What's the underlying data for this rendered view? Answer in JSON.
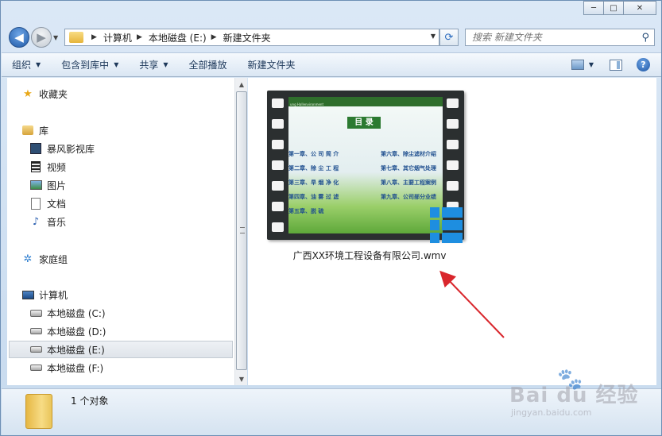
{
  "window": {
    "buttons": {
      "minimize": "─",
      "maximize": "□",
      "close": "✕"
    }
  },
  "address": {
    "breadcrumbs": [
      "计算机",
      "本地磁盘 (E:)",
      "新建文件夹"
    ],
    "separator": "▶"
  },
  "search": {
    "placeholder": "搜索 新建文件夹"
  },
  "toolbar": {
    "items": [
      {
        "label": "组织",
        "has_menu": true
      },
      {
        "label": "包含到库中",
        "has_menu": true
      },
      {
        "label": "共享",
        "has_menu": true
      },
      {
        "label": "全部播放",
        "has_menu": false
      },
      {
        "label": "新建文件夹",
        "has_menu": false
      }
    ],
    "help": "?"
  },
  "nav": {
    "favorites": "收藏夹",
    "libraries": "库",
    "library_items": [
      "暴风影视库",
      "视频",
      "图片",
      "文档",
      "音乐"
    ],
    "homegroup": "家庭组",
    "computer": "计算机",
    "drives": [
      "本地磁盘 (C:)",
      "本地磁盘 (D:)",
      "本地磁盘 (E:)",
      "本地磁盘 (F:)"
    ],
    "selected_drive": "本地磁盘 (E:)"
  },
  "file": {
    "name": "广西XX环境工程设备有限公司.wmv",
    "thumbnail": {
      "header": "ung Hallenvironment",
      "title": "目 录",
      "toc_left": [
        "第一章、公 司 简 介",
        "第二章、除 尘 工 程",
        "第三章、旱 烟 净 化",
        "第四章、油 雾 过 滤",
        "第五章、脱      硫"
      ],
      "toc_right": [
        "第六章、除尘滤材介绍",
        "第七章、其它烟气处理",
        "第八章、主要工程案例",
        "第九章、公司部分业绩"
      ]
    }
  },
  "status": {
    "count": "1 个对象"
  },
  "watermark": {
    "brand": "Bai du 经验",
    "url": "jingyan.baidu.com"
  },
  "colors": {
    "arrow": "#d9262c",
    "accent": "#1e8ee0"
  }
}
